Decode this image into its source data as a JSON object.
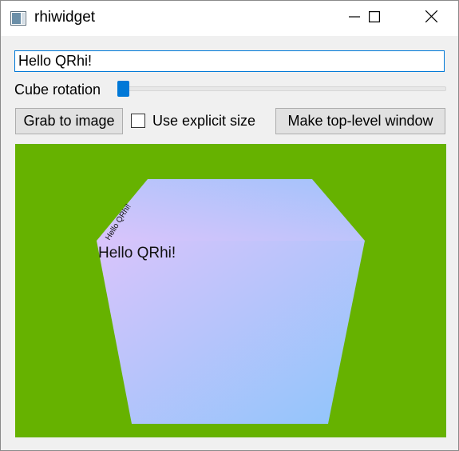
{
  "window": {
    "title": "rhiwidget"
  },
  "text_field": {
    "value": "Hello QRhi!"
  },
  "rotation": {
    "label": "Cube rotation",
    "value_fraction": 0.0
  },
  "buttons": {
    "grab": "Grab to image",
    "toplevel": "Make top-level window"
  },
  "checkbox": {
    "label": "Use explicit size",
    "checked": false
  },
  "viewport": {
    "background_color": "#66b200",
    "cube_text_front": "Hello QRhi!",
    "cube_text_top": "Hello QRhi!",
    "gradient_colors": [
      "#d9c4fb",
      "#c7bdf9",
      "#8fc5fb"
    ]
  },
  "colors": {
    "accent": "#0078d7",
    "button_face": "#e1e1e1",
    "window_bg": "#f0f0f0"
  },
  "icons": {
    "app": "window-app-icon",
    "minimize": "minimize-icon",
    "maximize": "maximize-icon",
    "close": "close-icon"
  }
}
